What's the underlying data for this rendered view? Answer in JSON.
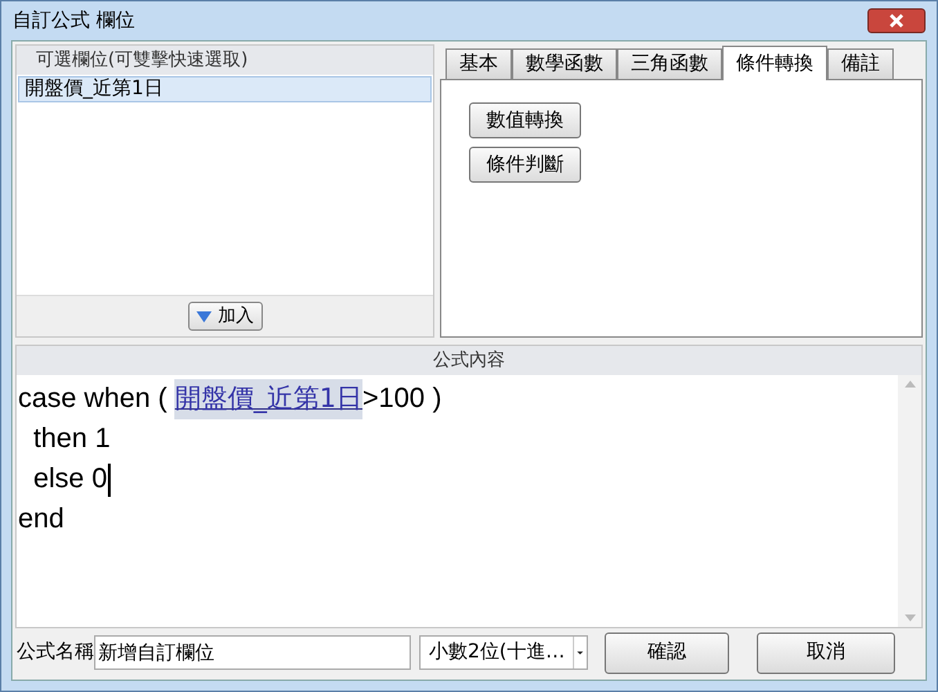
{
  "window": {
    "title": "自訂公式 欄位"
  },
  "fields_panel": {
    "header": "可選欄位(可雙擊快速選取)",
    "items": [
      {
        "label": "開盤價_近第1日",
        "selected": true
      }
    ],
    "add_button": "加入"
  },
  "tabs": [
    {
      "label": "基本",
      "selected": false
    },
    {
      "label": "數學函數",
      "selected": false
    },
    {
      "label": "三角函數",
      "selected": false
    },
    {
      "label": "條件轉換",
      "selected": true
    },
    {
      "label": "備註",
      "selected": false
    }
  ],
  "tab_buttons": [
    "數值轉換",
    "條件判斷"
  ],
  "formula": {
    "header": "公式內容",
    "lines": [
      [
        {
          "kind": "plain",
          "text": "case when ( "
        },
        {
          "kind": "field",
          "text": "開盤價_近第1日"
        },
        {
          "kind": "plain",
          "text": ">100 )"
        }
      ],
      [
        {
          "kind": "plain",
          "text": "  then 1"
        }
      ],
      [
        {
          "kind": "plain",
          "text": "  else 0"
        }
      ],
      [
        {
          "kind": "plain",
          "text": "end"
        }
      ]
    ]
  },
  "footer": {
    "name_label": "公式名稱",
    "name_value": "新增自訂欄位",
    "format": "小數2位(十進…",
    "buttons": [
      "確認",
      "取消"
    ]
  }
}
